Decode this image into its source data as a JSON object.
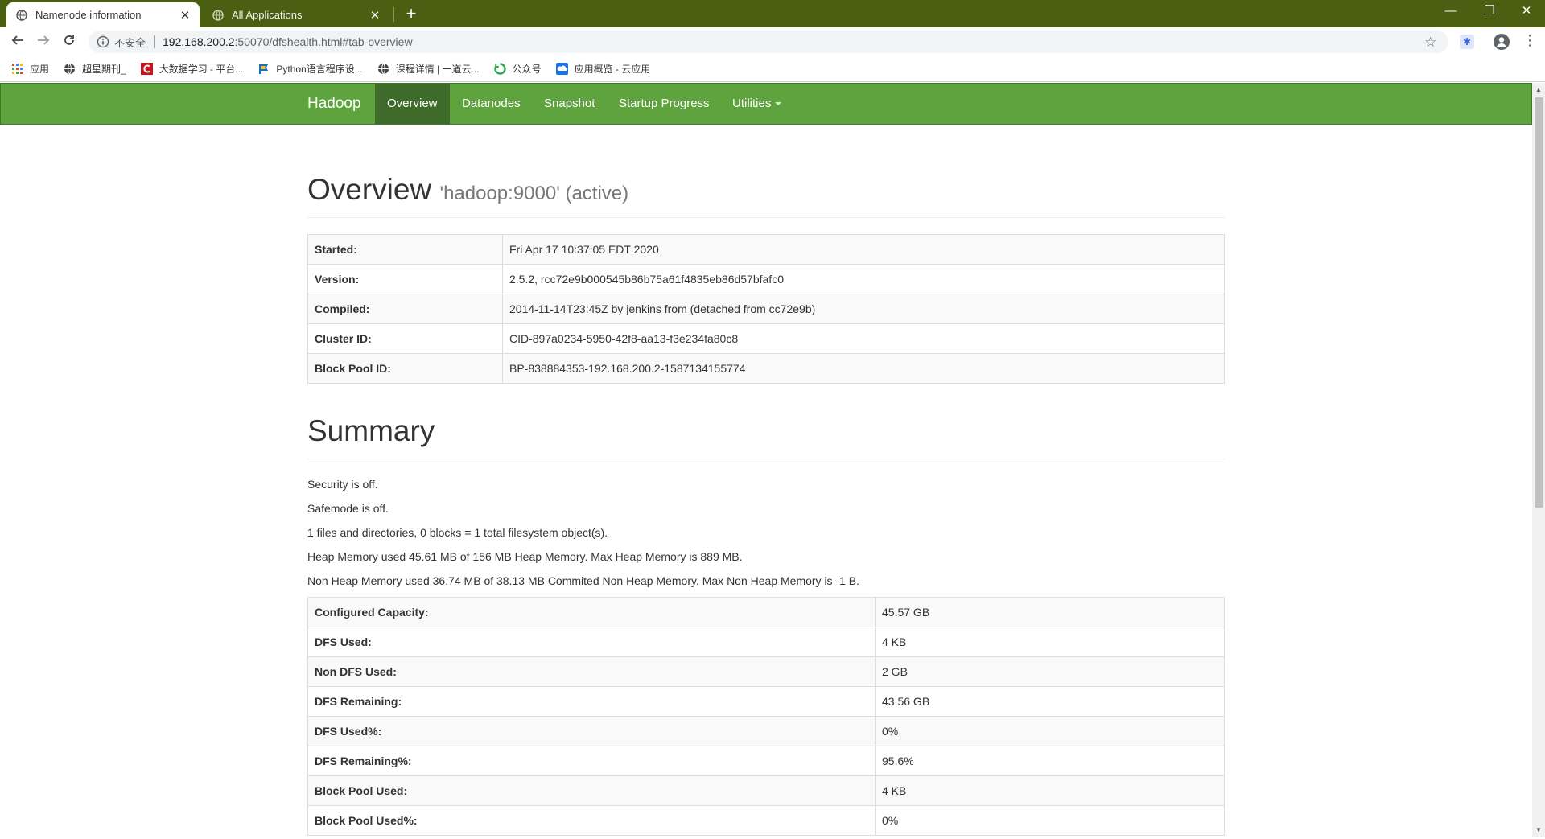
{
  "browser": {
    "tabs": [
      {
        "title": "Namenode information",
        "close": "✕"
      },
      {
        "title": "All Applications",
        "close": "✕"
      }
    ],
    "new_tab": "+",
    "window": {
      "minimize": "—",
      "restore": "❐",
      "close": "✕"
    },
    "omnibox": {
      "insecure": "不安全",
      "host": "192.168.200.2",
      "path": ":50070/dfshealth.html#tab-overview"
    },
    "bookmarks": [
      {
        "label": "应用",
        "icon": "apps-grid-icon",
        "color": "#d93025"
      },
      {
        "label": "超星期刊_",
        "icon": "globe-icon",
        "color": "#444444"
      },
      {
        "label": "大数据学习 - 平台...",
        "icon": "c-logo-icon",
        "color": "#c4161c"
      },
      {
        "label": "Python语言程序设...",
        "icon": "flag-icon",
        "color": "#1d6fb8"
      },
      {
        "label": "课程详情 | 一道云...",
        "icon": "globe-icon",
        "color": "#444444"
      },
      {
        "label": "公众号",
        "icon": "wechat-icon",
        "color": "#2ea44f"
      },
      {
        "label": "应用概览 - 云应用",
        "icon": "cloud-icon",
        "color": "#1a73e8"
      }
    ]
  },
  "hadoop": {
    "brand": "Hadoop",
    "nav": [
      "Overview",
      "Datanodes",
      "Snapshot",
      "Startup Progress",
      "Utilities"
    ],
    "active_nav": "Overview"
  },
  "overview": {
    "title": "Overview",
    "subtitle": "'hadoop:9000' (active)",
    "rows": [
      {
        "key": "Started:",
        "value": "Fri Apr 17 10:37:05 EDT 2020"
      },
      {
        "key": "Version:",
        "value": "2.5.2, rcc72e9b000545b86b75a61f4835eb86d57bfafc0"
      },
      {
        "key": "Compiled:",
        "value": "2014-11-14T23:45Z by jenkins from (detached from cc72e9b)"
      },
      {
        "key": "Cluster ID:",
        "value": "CID-897a0234-5950-42f8-aa13-f3e234fa80c8"
      },
      {
        "key": "Block Pool ID:",
        "value": "BP-838884353-192.168.200.2-1587134155774"
      }
    ]
  },
  "summary": {
    "title": "Summary",
    "lines": [
      "Security is off.",
      "Safemode is off.",
      "1 files and directories, 0 blocks = 1 total filesystem object(s).",
      "Heap Memory used 45.61 MB of 156 MB Heap Memory. Max Heap Memory is 889 MB.",
      "Non Heap Memory used 36.74 MB of 38.13 MB Commited Non Heap Memory. Max Non Heap Memory is -1 B."
    ],
    "rows": [
      {
        "key": "Configured Capacity:",
        "value": "45.57 GB"
      },
      {
        "key": "DFS Used:",
        "value": "4 KB"
      },
      {
        "key": "Non DFS Used:",
        "value": "2 GB"
      },
      {
        "key": "DFS Remaining:",
        "value": "43.56 GB"
      },
      {
        "key": "DFS Used%:",
        "value": "0%"
      },
      {
        "key": "DFS Remaining%:",
        "value": "95.6%"
      },
      {
        "key": "Block Pool Used:",
        "value": "4 KB"
      },
      {
        "key": "Block Pool Used%:",
        "value": "0%"
      }
    ]
  },
  "colors": {
    "tabstrip": "#4b5f13",
    "navbar": "#5fa33e",
    "navbar_active": "#3e6b2a"
  }
}
